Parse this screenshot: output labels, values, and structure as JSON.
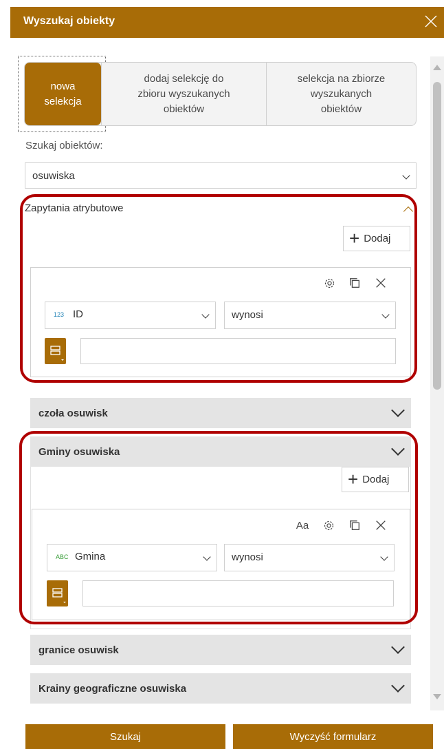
{
  "header": {
    "title": "Wyszukaj obiekty"
  },
  "tabs": [
    {
      "label": "nowa\nselekcja",
      "active": true
    },
    {
      "label": "dodaj selekcję do\nzbioru wyszukanych\nobiektów",
      "active": false
    },
    {
      "label": "selekcja na zbiorze\nwyszukanych\nobiektów",
      "active": false
    }
  ],
  "search": {
    "label": "Szukaj obiektów:",
    "layer": "osuwiska"
  },
  "attr_section": {
    "title": "Zapytania atrybutowe",
    "add_label": "Dodaj",
    "field_type": "123",
    "field": "ID",
    "operator": "wynosi",
    "value": ""
  },
  "sections": [
    {
      "title": "czoła osuwisk"
    },
    {
      "title": "Gminy osuwiska"
    },
    {
      "title": "granice osuwisk"
    },
    {
      "title": "Krainy geograficzne osuwiska"
    }
  ],
  "gminy_query": {
    "add_label": "Dodaj",
    "case_label": "Aa",
    "field_type": "ABC",
    "field": "Gmina",
    "operator": "wynosi",
    "value": ""
  },
  "footer": {
    "search_label": "Szukaj",
    "clear_label": "Wyczyść formularz"
  },
  "colors": {
    "accent": "#a86c07",
    "highlight": "#b00000"
  }
}
